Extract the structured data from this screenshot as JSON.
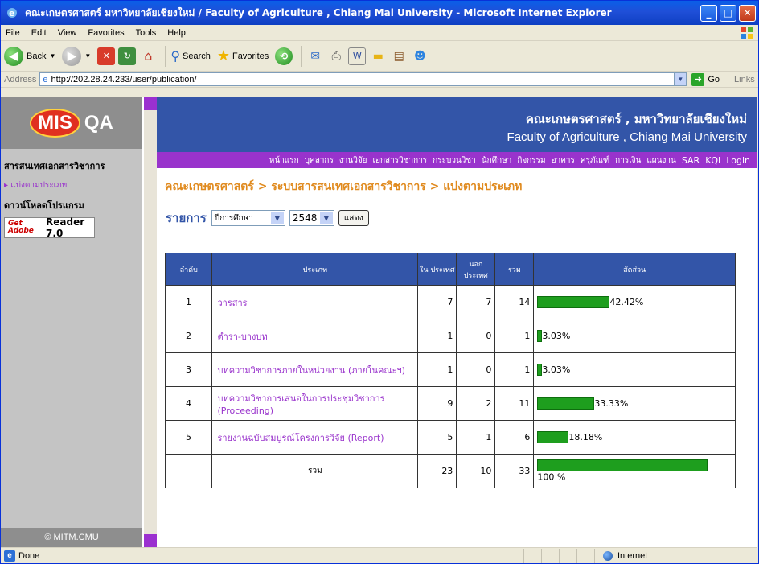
{
  "window": {
    "title": "คณะเกษตรศาสตร์ มหาวิทยาลัยเชียงใหม่ / Faculty of Agriculture , Chiang Mai University   - Microsoft Internet Explorer",
    "min": "_",
    "max": "□",
    "close": "✕"
  },
  "menu": [
    "File",
    "Edit",
    "View",
    "Favorites",
    "Tools",
    "Help"
  ],
  "toolbar": {
    "back": "Back",
    "search": "Search",
    "favorites": "Favorites"
  },
  "address": {
    "label": "Address",
    "url": "http://202.28.24.233/user/publication/",
    "go": "Go",
    "links": "Links"
  },
  "sidebar": {
    "logo_mis": "MIS",
    "logo_qa": "QA",
    "section_title": "สารสนเทศเอกสารวิชาการ",
    "link": "▸ แบ่งตามประเภท",
    "download_title": "ดาวน์โหลดโปรแกรม",
    "adobe_get": "Get Adobe",
    "adobe_reader": "Reader 7.0",
    "footer": "© MITM.CMU"
  },
  "header": {
    "thai": "คณะเกษตรศาสตร์ , มหาวิทยาลัยเชียงใหม่",
    "english": "Faculty of Agriculture , Chiang Mai University"
  },
  "nav": [
    "หน้าแรก",
    "บุคลากร",
    "งานวิจัย",
    "เอกสารวิชาการ",
    "กระบวนวิชา",
    "นักศึกษา",
    "กิจกรรม",
    "อาคาร",
    "ครุภัณฑ์",
    "การเงิน",
    "แผนงาน",
    "SAR",
    "KQI",
    "Login"
  ],
  "breadcrumb": "คณะเกษตรศาสตร์ > ระบบสารสนเทศเอกสารวิชาการ > แบ่งตามประเภท",
  "filter": {
    "label": "รายการ",
    "type_value": "ปีการศึกษา",
    "year_value": "2548",
    "show_button": "แสดง"
  },
  "table": {
    "headers": {
      "no": "ลำดับ",
      "type": "ประเภท",
      "domestic": "ใน ประเทศ",
      "foreign": "นอก ประเทศ",
      "total": "รวม",
      "ratio": "สัดส่วน"
    },
    "rows": [
      {
        "no": "1",
        "type": "วารสาร",
        "domestic": "7",
        "foreign": "7",
        "total": "14",
        "ratio": 42.42,
        "ratio_label": "42.42%"
      },
      {
        "no": "2",
        "type": "ตำรา-บางบท",
        "domestic": "1",
        "foreign": "0",
        "total": "1",
        "ratio": 3.03,
        "ratio_label": "3.03%"
      },
      {
        "no": "3",
        "type": "บทความวิชาการภายในหน่วยงาน (ภายในคณะฯ)",
        "domestic": "1",
        "foreign": "0",
        "total": "1",
        "ratio": 3.03,
        "ratio_label": "3.03%"
      },
      {
        "no": "4",
        "type": "บทความวิชาการเสนอในการประชุมวิชาการ (Proceeding)",
        "domestic": "9",
        "foreign": "2",
        "total": "11",
        "ratio": 33.33,
        "ratio_label": "33.33%"
      },
      {
        "no": "5",
        "type": "รายงานฉบับสมบูรณ์โครงการวิจัย (Report)",
        "domestic": "5",
        "foreign": "1",
        "total": "6",
        "ratio": 18.18,
        "ratio_label": "18.18%"
      }
    ],
    "total_row": {
      "label": "รวม",
      "domestic": "23",
      "foreign": "10",
      "total": "33",
      "ratio": 100,
      "ratio_label": "100 %"
    }
  },
  "status": {
    "text": "Done",
    "zone": "Internet"
  },
  "colors": {
    "header_blue": "#3355A8",
    "nav_purple": "#9933CC",
    "bar_green": "#1E9E1E",
    "breadcrumb_orange": "#E08A1E"
  }
}
